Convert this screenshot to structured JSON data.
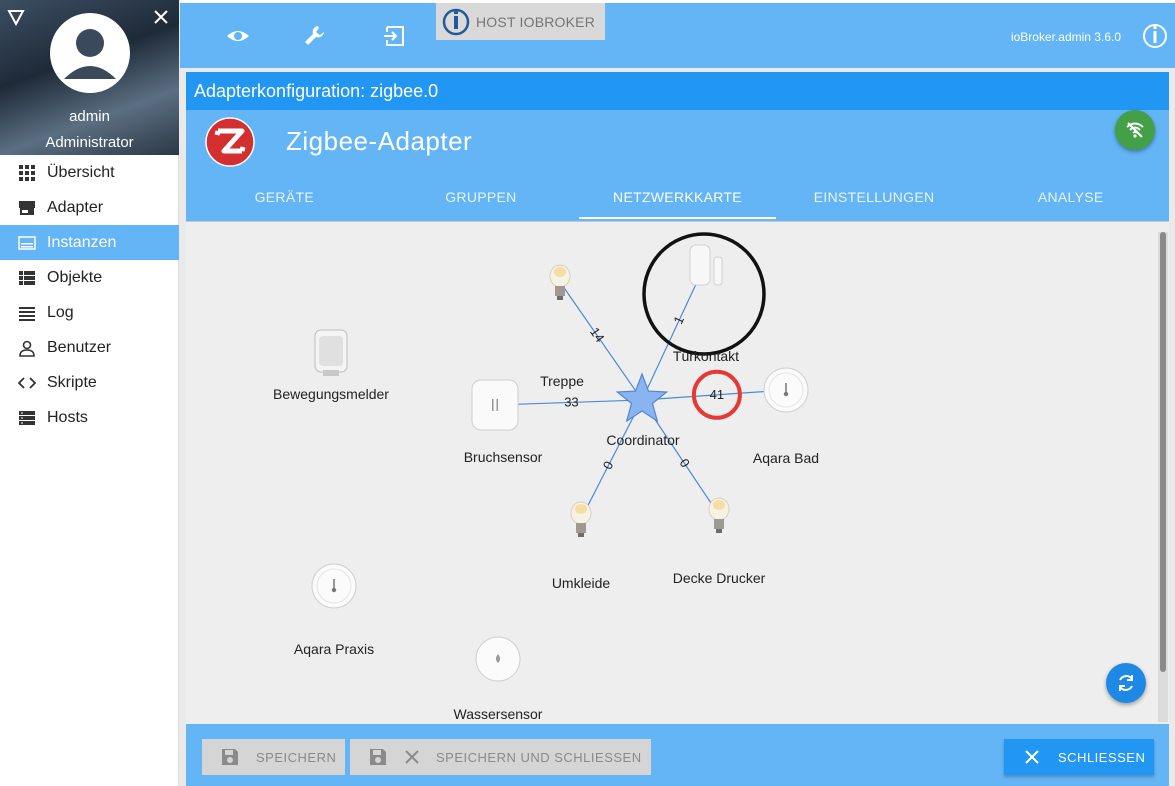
{
  "sidebar": {
    "user_name": "admin",
    "user_role": "Administrator",
    "items": [
      {
        "label": "Übersicht",
        "icon": "grid-icon",
        "active": false
      },
      {
        "label": "Adapter",
        "icon": "store-icon",
        "active": false
      },
      {
        "label": "Instanzen",
        "icon": "instances-icon",
        "active": true
      },
      {
        "label": "Objekte",
        "icon": "list-icon",
        "active": false
      },
      {
        "label": "Log",
        "icon": "lines-icon",
        "active": false
      },
      {
        "label": "Benutzer",
        "icon": "person-icon",
        "active": false
      },
      {
        "label": "Skripte",
        "icon": "code-icon",
        "active": false
      },
      {
        "label": "Hosts",
        "icon": "hosts-icon",
        "active": false
      }
    ]
  },
  "topbar": {
    "host_label": "HOST IOBROKER",
    "version": "ioBroker.admin 3.6.0"
  },
  "dialog": {
    "title": "Adapterkonfiguration: zigbee.0",
    "adapter_name": "Zigbee-Adapter",
    "tabs": [
      "GERÄTE",
      "GRUPPEN",
      "NETZWERKKARTE",
      "EINSTELLUNGEN",
      "ANALYSE"
    ],
    "active_tab": 2
  },
  "network_map": {
    "coordinator": {
      "label": "Coordinator"
    },
    "nodes": [
      {
        "id": "treppe",
        "label": "Treppe",
        "device": "bulb",
        "link": "14",
        "connected": true
      },
      {
        "id": "tuerkontakt",
        "label": "Türkontakt",
        "device": "door-contact",
        "link": "1",
        "connected": true,
        "highlight": "black-circle"
      },
      {
        "id": "bruchsensor",
        "label": "Bruchsensor",
        "device": "button",
        "link": "33",
        "connected": true
      },
      {
        "id": "aqara_bad",
        "label": "Aqara Bad",
        "device": "round-sensor",
        "link": "41",
        "connected": true,
        "highlight": "red-circle"
      },
      {
        "id": "umkleide",
        "label": "Umkleide",
        "device": "bulb",
        "link": "0",
        "connected": true
      },
      {
        "id": "decke_drucker",
        "label": "Decke Drucker",
        "device": "bulb",
        "link": "0",
        "connected": true
      },
      {
        "id": "bewegungsmelder",
        "label": "Bewegungsmelder",
        "device": "motion",
        "connected": false
      },
      {
        "id": "aqara_praxis",
        "label": "Aqara Praxis",
        "device": "round-sensor",
        "connected": false
      },
      {
        "id": "wassersensor",
        "label": "Wassersensor",
        "device": "water-sensor",
        "connected": false
      }
    ]
  },
  "footer": {
    "save_label": "SPEICHERN",
    "save_close_label": "SPEICHERN UND SCHLIESSEN",
    "close_label": "SCHLIESSEN"
  },
  "colors": {
    "primary": "#2196f3",
    "primary_light": "#64b5f6",
    "success": "#43a047",
    "highlight_red": "#e53935"
  }
}
